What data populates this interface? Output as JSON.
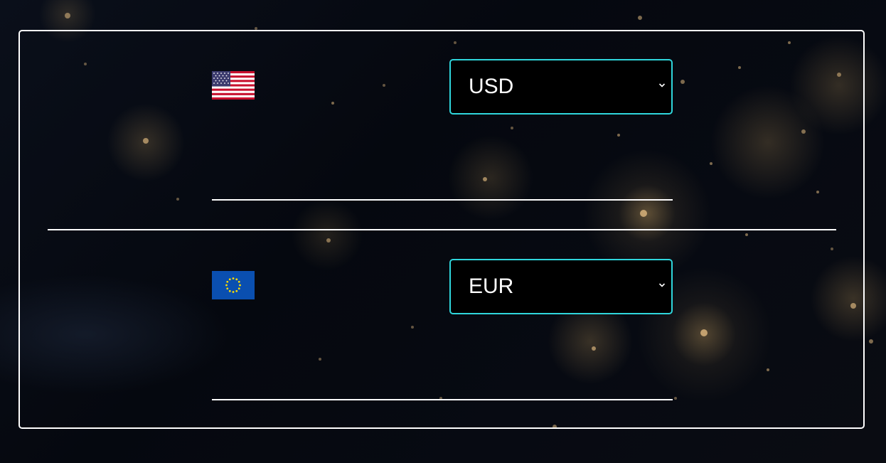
{
  "background": {
    "description_icon": "city-lights-night-earth-image"
  },
  "from": {
    "currency": "USD",
    "flag_icon": "us-flag-icon",
    "amount": "",
    "options": [
      "USD"
    ]
  },
  "to": {
    "currency": "EUR",
    "flag_icon": "eu-flag-icon",
    "amount": "",
    "options": [
      "EUR"
    ]
  },
  "colors": {
    "select_border": "#2fd6dc",
    "card_border": "#ffffff",
    "background": "#05080f"
  }
}
